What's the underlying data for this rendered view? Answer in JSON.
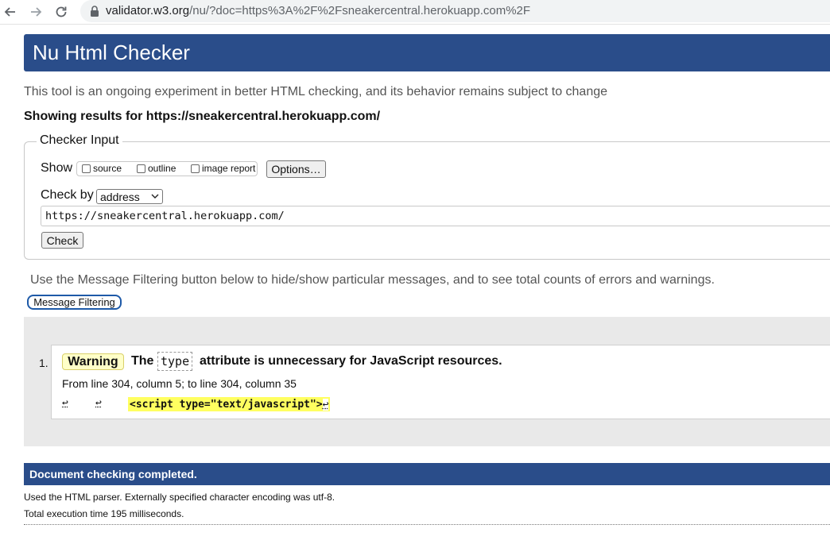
{
  "browser": {
    "url_host": "validator.w3.org",
    "url_path": "/nu/?doc=https%3A%2F%2Fsneakercentral.herokuapp.com%2F"
  },
  "header": {
    "title": "Nu Html Checker"
  },
  "intro": "This tool is an ongoing experiment in better HTML checking, and its behavior remains subject to change",
  "showing": "Showing results for https://sneakercentral.herokuapp.com/",
  "checker_input": {
    "legend": "Checker Input",
    "show_label": "Show",
    "options": [
      "source",
      "outline",
      "image report"
    ],
    "options_button": "Options…",
    "check_by_label": "Check by",
    "check_by_value": "address",
    "document_url": "https://sneakercentral.herokuapp.com/",
    "check_button": "Check"
  },
  "filter": {
    "message": "Use the Message Filtering button below to hide/show particular messages, and to see total counts of errors and warnings.",
    "button": "Message Filtering"
  },
  "results": {
    "item_number": "1.",
    "badge": "Warning",
    "title_pre": "The",
    "title_code": "type",
    "title_post": "attribute is unnecessary for JavaScript resources.",
    "location": "From line 304, column 5; to line 304, column 35",
    "return_marker": "↩",
    "code": "<script type=\"text/javascript\">"
  },
  "footer": {
    "done": "Document checking completed.",
    "parser": "Used the HTML parser. Externally specified character encoding was utf-8.",
    "timing": "Total execution time 195 milliseconds."
  },
  "colors": {
    "header_bg": "#2a4d8a",
    "warning_bg": "#ffffc8",
    "code_highlight": "#ffff60"
  }
}
